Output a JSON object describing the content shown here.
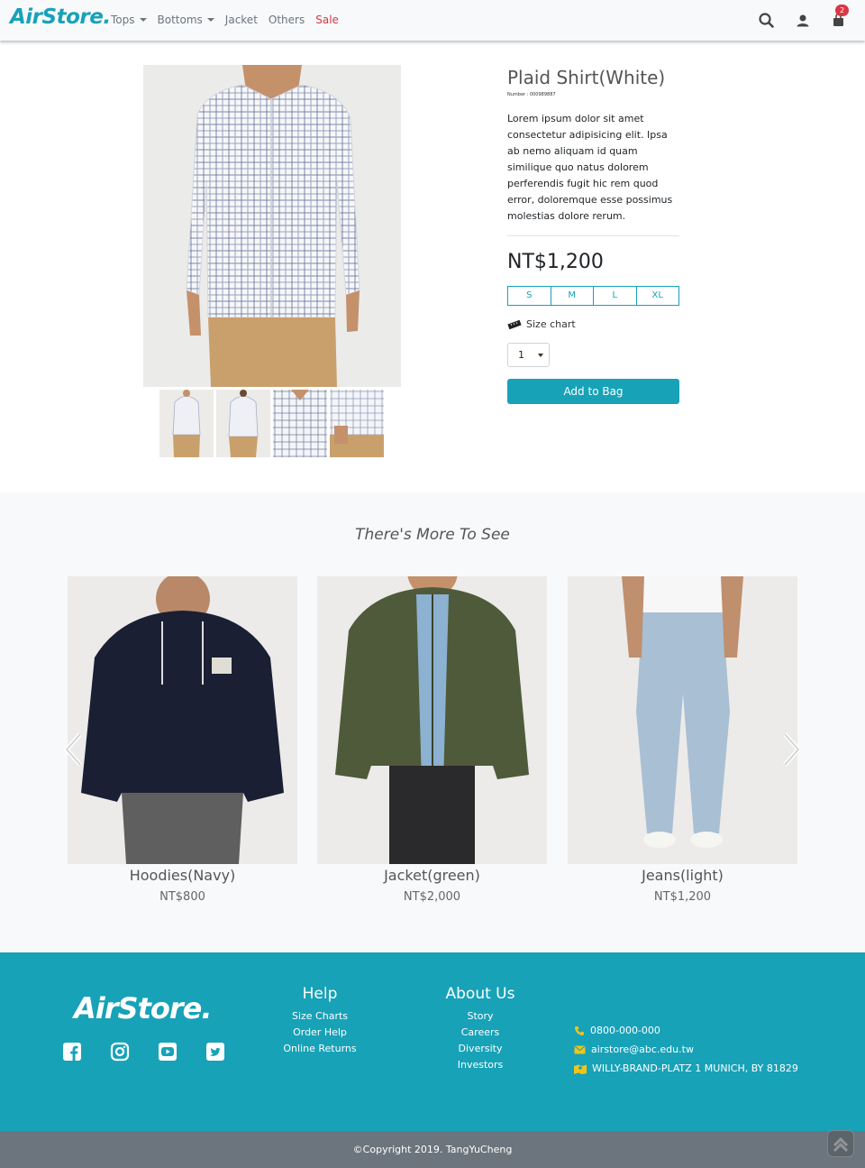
{
  "nav": {
    "brand": "AirStore.",
    "links": [
      {
        "label": "Tops",
        "dropdown": true
      },
      {
        "label": "Bottoms",
        "dropdown": true
      },
      {
        "label": "Jacket",
        "dropdown": false
      },
      {
        "label": "Others",
        "dropdown": false
      },
      {
        "label": "Sale",
        "dropdown": false
      }
    ],
    "icons": [
      "search-icon",
      "user-icon",
      "shopping-bag-icon"
    ],
    "cart_count": "2"
  },
  "product": {
    "title": "Plaid Shirt(White)",
    "number": "Number : 000989887",
    "description": "Lorem ipsum dolor sit amet consectetur adipisicing elit. Ipsa ab nemo aliquam id quam similique quo natus dolorem perferendis fugit hic rem quod error, doloremque esse possimus molestias dolore rerum.",
    "price": "NT$1,200",
    "sizes": [
      "S",
      "M",
      "L",
      "XL"
    ],
    "size_chart": "Size chart",
    "quantity": "1",
    "add_button": "Add to Bag"
  },
  "more": {
    "title": "There's More To See",
    "items": [
      {
        "name": "Hoodies(Navy)",
        "price": "NT$800"
      },
      {
        "name": "Jacket(green)",
        "price": "NT$2,000"
      },
      {
        "name": "Jeans(light)",
        "price": "NT$1,200"
      }
    ]
  },
  "footer": {
    "brand": "AirStore.",
    "help": {
      "title": "Help",
      "links": [
        "Size Charts",
        "Order Help",
        "Online Returns"
      ]
    },
    "about": {
      "title": "About Us",
      "links": [
        "Story",
        "Careers",
        "Diversity",
        "Investors"
      ]
    },
    "phone": "0800-000-000",
    "email": "airstore@abc.edu.tw",
    "address": "WILLY-BRAND-PLATZ 1 MUNICH, BY 81829",
    "copyright": "©Copyright 2019. TangYuCheng"
  },
  "colors": {
    "accent": "#17a2b8",
    "sale": "#dc3545",
    "icon_yellow": "#f0c419"
  }
}
